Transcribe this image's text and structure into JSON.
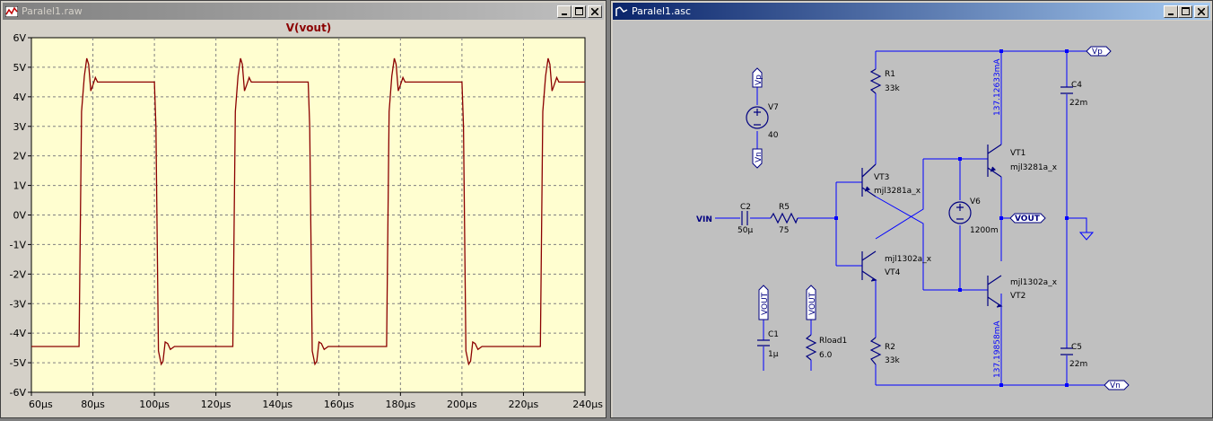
{
  "waveform_window": {
    "title": "Paralel1.raw",
    "plot_title": "V(vout)",
    "y_ticks": [
      "6V",
      "5V",
      "4V",
      "3V",
      "2V",
      "1V",
      "0V",
      "-1V",
      "-2V",
      "-3V",
      "-4V",
      "-5V",
      "-6V"
    ],
    "x_ticks": [
      "60µs",
      "80µs",
      "100µs",
      "120µs",
      "140µs",
      "160µs",
      "180µs",
      "200µs",
      "220µs",
      "240µs"
    ],
    "trace_color": "#8b0000",
    "plot_bg": "#fffed0"
  },
  "chart_data": {
    "type": "line",
    "title": "V(vout)",
    "xlabel": "",
    "ylabel": "",
    "xlim": [
      60,
      240
    ],
    "ylim": [
      -6,
      6
    ],
    "x_unit": "µs",
    "y_unit": "V",
    "grid": true,
    "series": [
      {
        "name": "V(vout)",
        "color": "#8b0000",
        "x": [
          60,
          75.5,
          76.3,
          77.2,
          78,
          78.6,
          79.3,
          80,
          80.8,
          81.5,
          82.5,
          84,
          100,
          100.5,
          101.3,
          102.2,
          102.8,
          103.5,
          104.3,
          105.2,
          106.5,
          108,
          125.5,
          126.3,
          127.2,
          128,
          128.6,
          129.3,
          130,
          130.8,
          131.5,
          132.5,
          134,
          150,
          150.5,
          151.3,
          152.2,
          152.8,
          153.5,
          154.3,
          155.2,
          156.5,
          158,
          175.5,
          176.3,
          177.2,
          178,
          178.6,
          179.3,
          180,
          180.8,
          181.5,
          182.5,
          184,
          200,
          200.5,
          201.3,
          202.2,
          202.8,
          203.5,
          204.3,
          205.2,
          206.5,
          208,
          225.5,
          226.3,
          227.2,
          228,
          228.6,
          229.3,
          230,
          230.8,
          231.5,
          232.5,
          234,
          240
        ],
        "y": [
          -4.45,
          -4.45,
          3.5,
          4.7,
          5.3,
          5.1,
          4.2,
          4.4,
          4.65,
          4.5,
          4.5,
          4.5,
          4.5,
          3.0,
          -4.6,
          -5.05,
          -4.95,
          -4.3,
          -4.35,
          -4.55,
          -4.45,
          -4.45,
          -4.45,
          3.5,
          4.7,
          5.3,
          5.1,
          4.2,
          4.4,
          4.65,
          4.5,
          4.5,
          4.5,
          4.5,
          3.0,
          -4.6,
          -5.05,
          -4.95,
          -4.3,
          -4.35,
          -4.55,
          -4.45,
          -4.45,
          -4.45,
          3.5,
          4.7,
          5.3,
          5.1,
          4.2,
          4.4,
          4.65,
          4.5,
          4.5,
          4.5,
          4.5,
          3.0,
          -4.6,
          -5.05,
          -4.95,
          -4.3,
          -4.35,
          -4.55,
          -4.45,
          -4.45,
          -4.45,
          3.5,
          4.7,
          5.3,
          5.1,
          4.2,
          4.4,
          4.65,
          4.5,
          4.5,
          4.5,
          4.5
        ]
      }
    ]
  },
  "schematic_window": {
    "title": "Paralel1.asc",
    "wire_color": "#0000ff",
    "component_color": "#000080",
    "canvas_bg": "#c0c0c0",
    "labels": {
      "vp_top": "Vp",
      "vn_bottom": "Vn",
      "vout_flag": "VOUT",
      "vin": "VIN",
      "vp_v7": "Vp",
      "vn_v7": "Vn",
      "vout_c1": "VOUT",
      "vout_rload": "VOUT"
    },
    "components": {
      "r1_name": "R1",
      "r1_value": "33k",
      "r2_name": "R2",
      "r2_value": "33k",
      "r5_name": "R5",
      "r5_value": "75",
      "c2_name": "C2",
      "c2_value": "50µ",
      "c4_name": "C4",
      "c4_value": "22m",
      "c5_name": "C5",
      "c5_value": "22m",
      "c1_name": "C1",
      "c1_value": "1µ",
      "v7_name": "V7",
      "v7_value": "40",
      "v6_name": "V6",
      "v6_value": "1200m",
      "rload_name": "Rload1",
      "rload_value": "6.0",
      "vt1_name": "VT1",
      "vt1_model": "mjl3281a_x",
      "vt2_name": "VT2",
      "vt2_model": "mjl1302a_x",
      "vt3_name": "VT3",
      "vt3_model": "mjl3281a_x",
      "vt4_name": "VT4",
      "vt4_model": "mjl1302a_x"
    },
    "currents": {
      "upper": "137.12633mA",
      "lower": "137.19858mA"
    }
  }
}
